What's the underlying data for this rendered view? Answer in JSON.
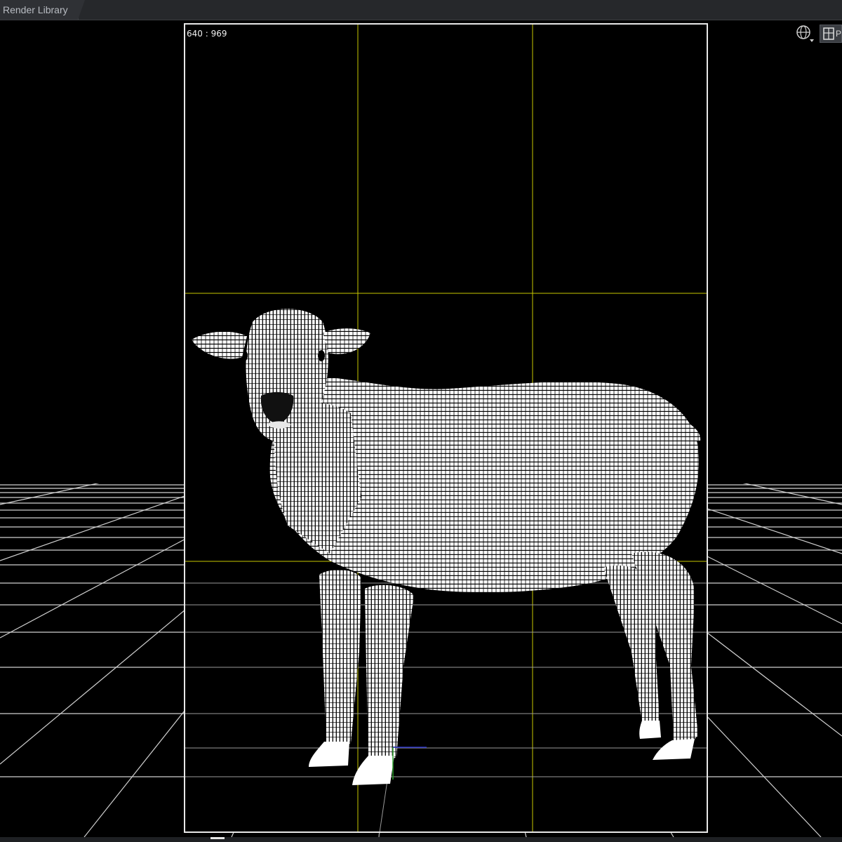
{
  "tabs": [
    {
      "label": "Render Library"
    }
  ],
  "viewport": {
    "aspect_readout": "640 : 969",
    "camera_menu_icon": "globe-icon",
    "view_button_icon": "perspective-view-icon",
    "view_button_label": "P",
    "colors": {
      "background": "#000000",
      "grid": "#cfcfcf",
      "guides": "#c8c800",
      "frame": "#e8e8e8",
      "mesh": "#ffffff"
    }
  },
  "scene": {
    "subject": "sheep-wireframe-icon"
  }
}
